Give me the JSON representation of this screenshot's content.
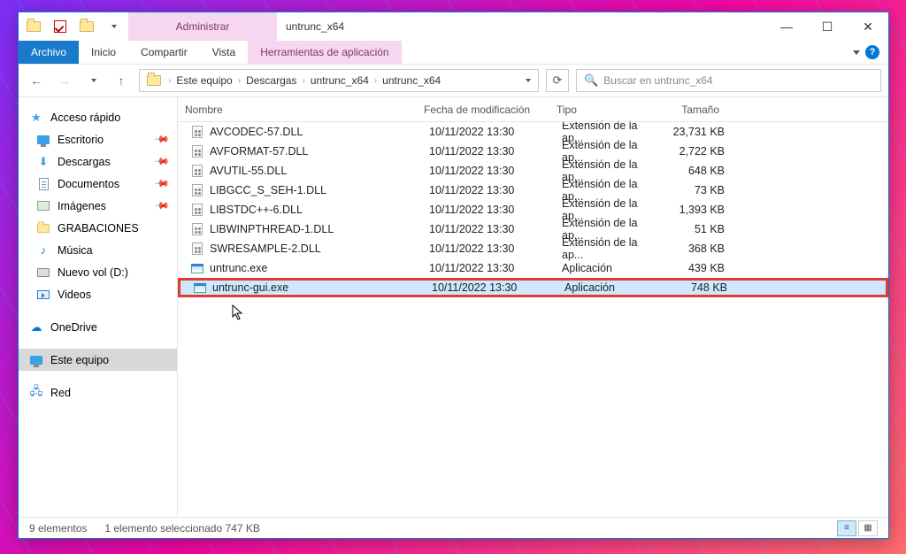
{
  "titlebar": {
    "context_tab": "Administrar",
    "window_title": "untrunc_x64"
  },
  "ribbon": {
    "file": "Archivo",
    "tabs": [
      "Inicio",
      "Compartir",
      "Vista"
    ],
    "context_tab": "Herramientas de aplicación"
  },
  "breadcrumb": {
    "items": [
      "Este equipo",
      "Descargas",
      "untrunc_x64",
      "untrunc_x64"
    ]
  },
  "search": {
    "placeholder": "Buscar en untrunc_x64"
  },
  "columns": {
    "name": "Nombre",
    "date": "Fecha de modificación",
    "type": "Tipo",
    "size": "Tamaño"
  },
  "sidebar": {
    "quick_access": "Acceso rápido",
    "qa_items": [
      {
        "label": "Escritorio",
        "icon": "monitor",
        "pinned": true
      },
      {
        "label": "Descargas",
        "icon": "download",
        "pinned": true
      },
      {
        "label": "Documentos",
        "icon": "document",
        "pinned": true
      },
      {
        "label": "Imágenes",
        "icon": "picture",
        "pinned": true
      },
      {
        "label": "GRABACIONES",
        "icon": "folder",
        "pinned": false
      },
      {
        "label": "Música",
        "icon": "note",
        "pinned": false
      },
      {
        "label": "Nuevo vol (D:)",
        "icon": "drive",
        "pinned": false
      },
      {
        "label": "Videos",
        "icon": "video",
        "pinned": false
      }
    ],
    "onedrive": "OneDrive",
    "this_pc": "Este equipo",
    "network": "Red"
  },
  "files": [
    {
      "name": "AVCODEC-57.DLL",
      "date": "10/11/2022 13:30",
      "type": "Extensión de la ap...",
      "size": "23,731 KB",
      "icon": "dll"
    },
    {
      "name": "AVFORMAT-57.DLL",
      "date": "10/11/2022 13:30",
      "type": "Extensión de la ap...",
      "size": "2,722 KB",
      "icon": "dll"
    },
    {
      "name": "AVUTIL-55.DLL",
      "date": "10/11/2022 13:30",
      "type": "Extensión de la ap...",
      "size": "648 KB",
      "icon": "dll"
    },
    {
      "name": "LIBGCC_S_SEH-1.DLL",
      "date": "10/11/2022 13:30",
      "type": "Extensión de la ap...",
      "size": "73 KB",
      "icon": "dll"
    },
    {
      "name": "LIBSTDC++-6.DLL",
      "date": "10/11/2022 13:30",
      "type": "Extensión de la ap...",
      "size": "1,393 KB",
      "icon": "dll"
    },
    {
      "name": "LIBWINPTHREAD-1.DLL",
      "date": "10/11/2022 13:30",
      "type": "Extensión de la ap...",
      "size": "51 KB",
      "icon": "dll"
    },
    {
      "name": "SWRESAMPLE-2.DLL",
      "date": "10/11/2022 13:30",
      "type": "Extensión de la ap...",
      "size": "368 KB",
      "icon": "dll"
    },
    {
      "name": "untrunc.exe",
      "date": "10/11/2022 13:30",
      "type": "Aplicación",
      "size": "439 KB",
      "icon": "exe"
    },
    {
      "name": "untrunc-gui.exe",
      "date": "10/11/2022 13:30",
      "type": "Aplicación",
      "size": "748 KB",
      "icon": "exe",
      "selected": true,
      "highlighted": true
    }
  ],
  "status": {
    "count": "9 elementos",
    "selection": "1 elemento seleccionado  747 KB"
  }
}
